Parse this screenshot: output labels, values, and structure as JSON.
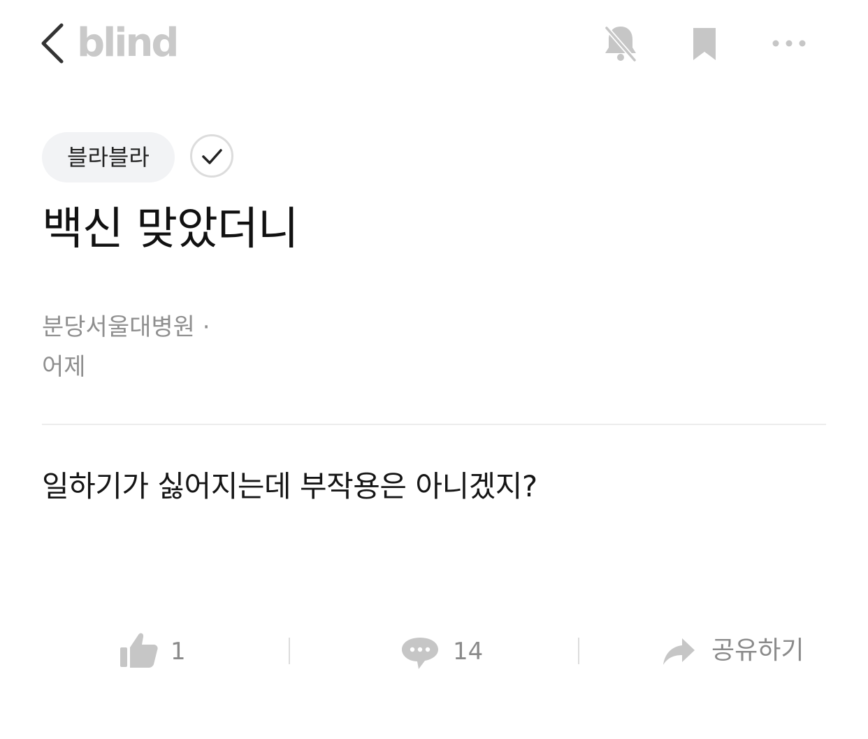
{
  "header": {
    "logo": "blind",
    "icons": [
      "chevron-left-icon",
      "bell-off-icon",
      "bookmark-icon",
      "more-icon"
    ]
  },
  "post": {
    "category": "블라블라",
    "title": "백신 맞았더니",
    "company": "분당서울대병원 ·",
    "time": "어제",
    "body": "일하기가 싫어지는데 부작용은 아니겠지?"
  },
  "actions": {
    "like_count": "1",
    "comment_count": "14",
    "share_label": "공유하기"
  },
  "colors": {
    "icon_gray": "#c6c6c6",
    "action_gray": "#8a8a8a",
    "chip_bg": "#f2f3f5"
  }
}
